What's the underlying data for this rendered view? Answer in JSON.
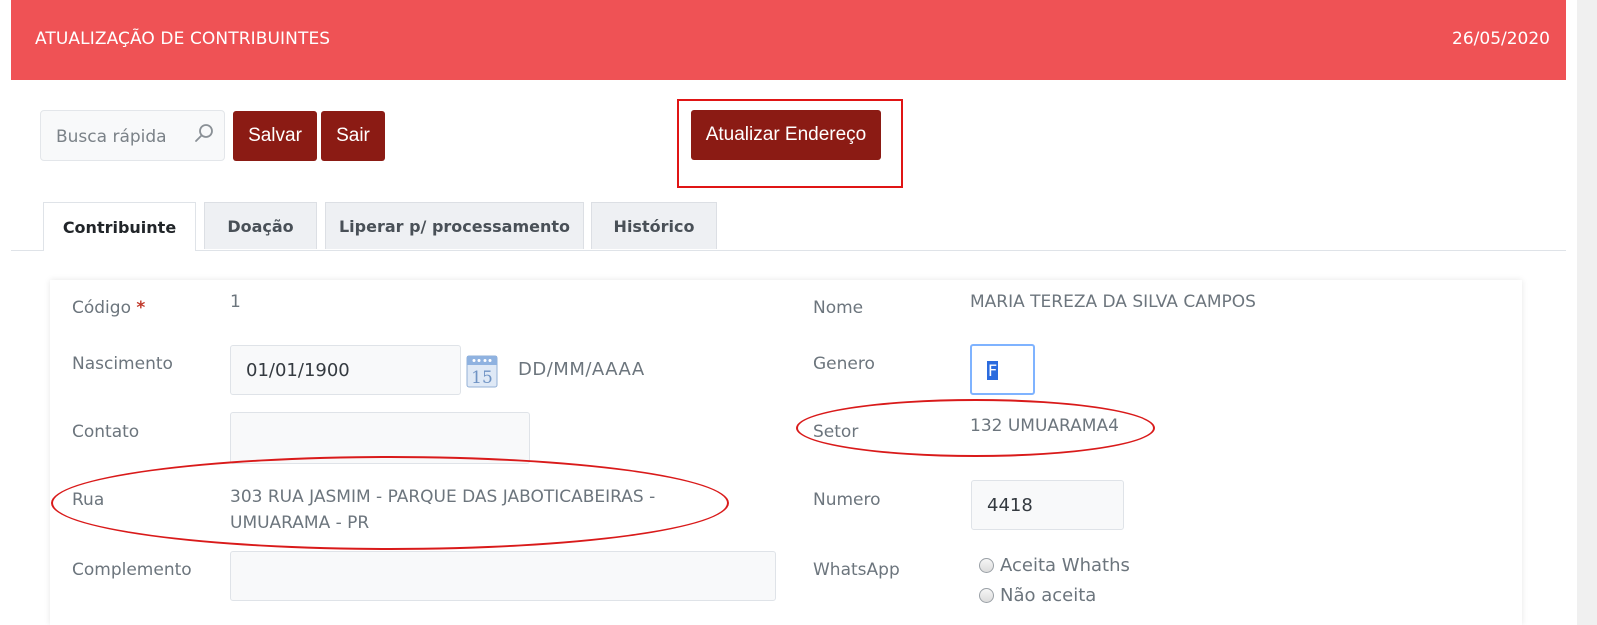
{
  "header": {
    "title": "ATUALIZAÇÃO DE CONTRIBUINTES",
    "date": "26/05/2020"
  },
  "toolbar": {
    "search_placeholder": "Busca rápida",
    "save_label": "Salvar",
    "exit_label": "Sair",
    "update_address_label": "Atualizar Endereço"
  },
  "tabs": [
    {
      "label": "Contribuinte",
      "active": true
    },
    {
      "label": "Doação",
      "active": false
    },
    {
      "label": "Liperar p/ processamento",
      "active": false
    },
    {
      "label": "Histórico",
      "active": false
    }
  ],
  "form": {
    "codigo": {
      "label": "Código",
      "required_mark": "*",
      "value": "1"
    },
    "nome": {
      "label": "Nome",
      "value": "MARIA TEREZA DA SILVA CAMPOS"
    },
    "nascimento": {
      "label": "Nascimento",
      "value": "01/01/1900",
      "format_hint": "DD/MM/AAAA",
      "calendar_day": "15"
    },
    "genero": {
      "label": "Genero",
      "value": "F"
    },
    "contato": {
      "label": "Contato",
      "value": ""
    },
    "setor": {
      "label": "Setor",
      "value": "132 UMUARAMA4"
    },
    "rua": {
      "label": "Rua",
      "line1": "303 RUA JASMIM - PARQUE DAS JABOTICABEIRAS -",
      "line2": "UMUARAMA - PR"
    },
    "numero": {
      "label": "Numero",
      "value": "4418"
    },
    "complemento": {
      "label": "Complemento",
      "value": ""
    },
    "whatsapp": {
      "label": "WhatsApp",
      "options": [
        "Aceita Whaths",
        "Não aceita"
      ]
    }
  },
  "colors": {
    "header_bg": "#ef5255",
    "button_bg": "#8b1b14",
    "annotation": "#d91a1a",
    "focus": "#7fb3ff"
  },
  "icons": {
    "search": "magnifier-icon",
    "calendar": "calendar-icon"
  }
}
